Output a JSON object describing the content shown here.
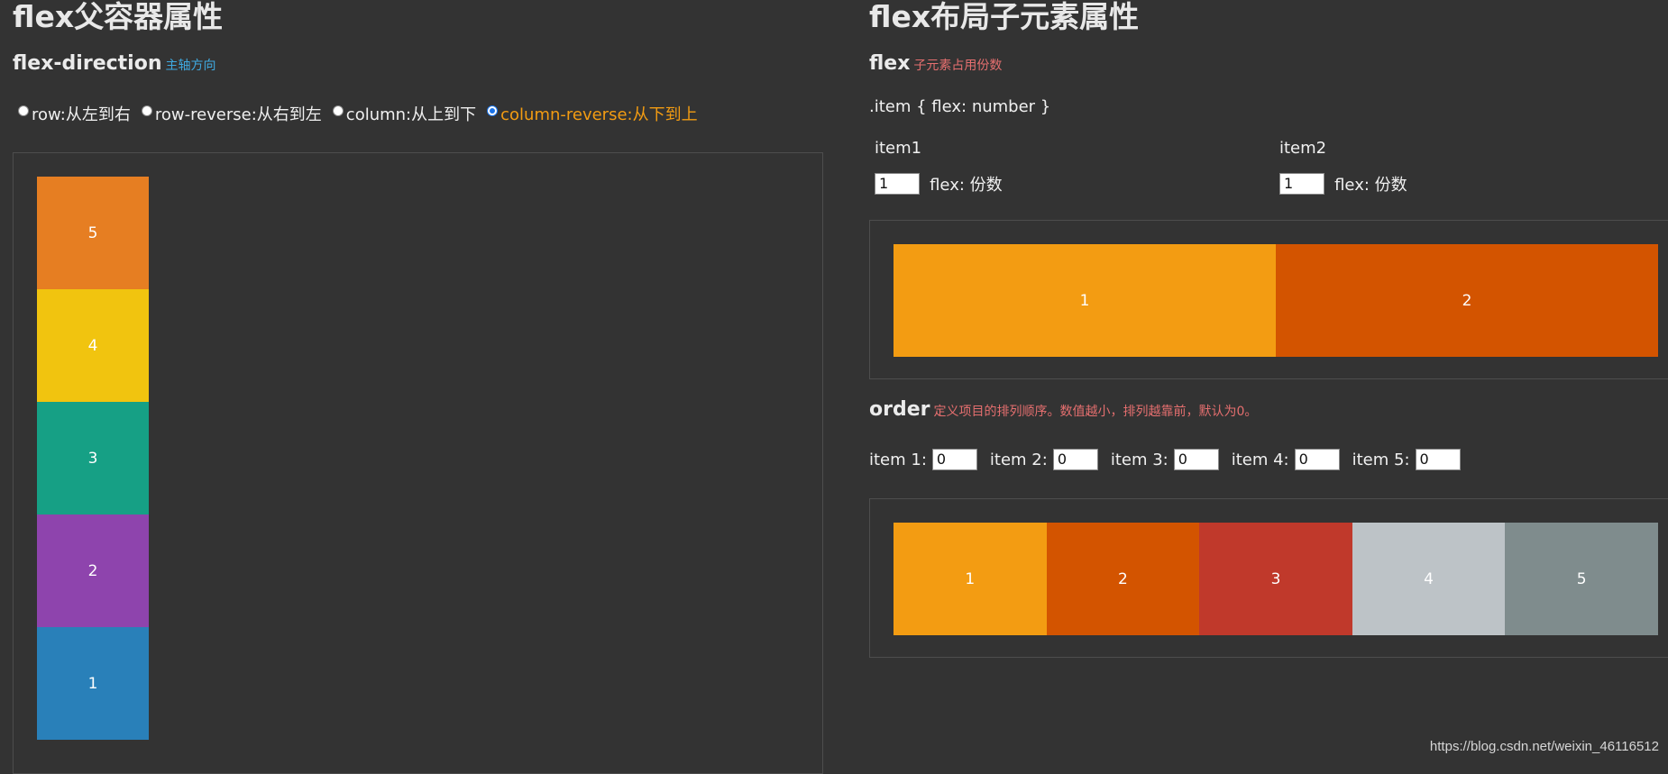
{
  "left": {
    "heading": "flex父容器属性",
    "section_title": "flex-direction",
    "section_note": "主轴方向",
    "radios": [
      {
        "label": "row:从左到右",
        "checked": false
      },
      {
        "label": "row-reverse:从右到左",
        "checked": false
      },
      {
        "label": "column:从上到下",
        "checked": false
      },
      {
        "label": "column-reverse:从下到上",
        "checked": true
      }
    ],
    "stack_items": [
      {
        "label": "5",
        "color": "#e67e22"
      },
      {
        "label": "4",
        "color": "#f1c40f"
      },
      {
        "label": "3",
        "color": "#16a085"
      },
      {
        "label": "2",
        "color": "#8e44ad"
      },
      {
        "label": "1",
        "color": "#2980b9"
      }
    ]
  },
  "right": {
    "heading": "flex布局子元素属性",
    "flex_title": "flex",
    "flex_note": "子元素占用份数",
    "code_line": ".item { flex: number }",
    "item1_label": "item1",
    "item1_value": "1",
    "item1_suffix": "flex: 份数",
    "item2_label": "item2",
    "item2_value": "1",
    "item2_suffix": "flex: 份数",
    "flex_items": [
      {
        "label": "1",
        "color": "#f39c12"
      },
      {
        "label": "2",
        "color": "#d35400"
      }
    ],
    "order_title": "order",
    "order_note": "定义项目的排列顺序。数值越小，排列越靠前，默认为0。",
    "order_inputs": [
      {
        "label": "item 1:",
        "value": "0"
      },
      {
        "label": "item 2:",
        "value": "0"
      },
      {
        "label": "item 3:",
        "value": "0"
      },
      {
        "label": "item 4:",
        "value": "0"
      },
      {
        "label": "item 5:",
        "value": "0"
      }
    ],
    "order_items": [
      {
        "label": "1",
        "color": "#f39c12"
      },
      {
        "label": "2",
        "color": "#d35400"
      },
      {
        "label": "3",
        "color": "#c0392b"
      },
      {
        "label": "4",
        "color": "#bdc3c7"
      },
      {
        "label": "5",
        "color": "#7f8c8d"
      }
    ]
  },
  "watermark": "https://blog.csdn.net/weixin_46116512"
}
